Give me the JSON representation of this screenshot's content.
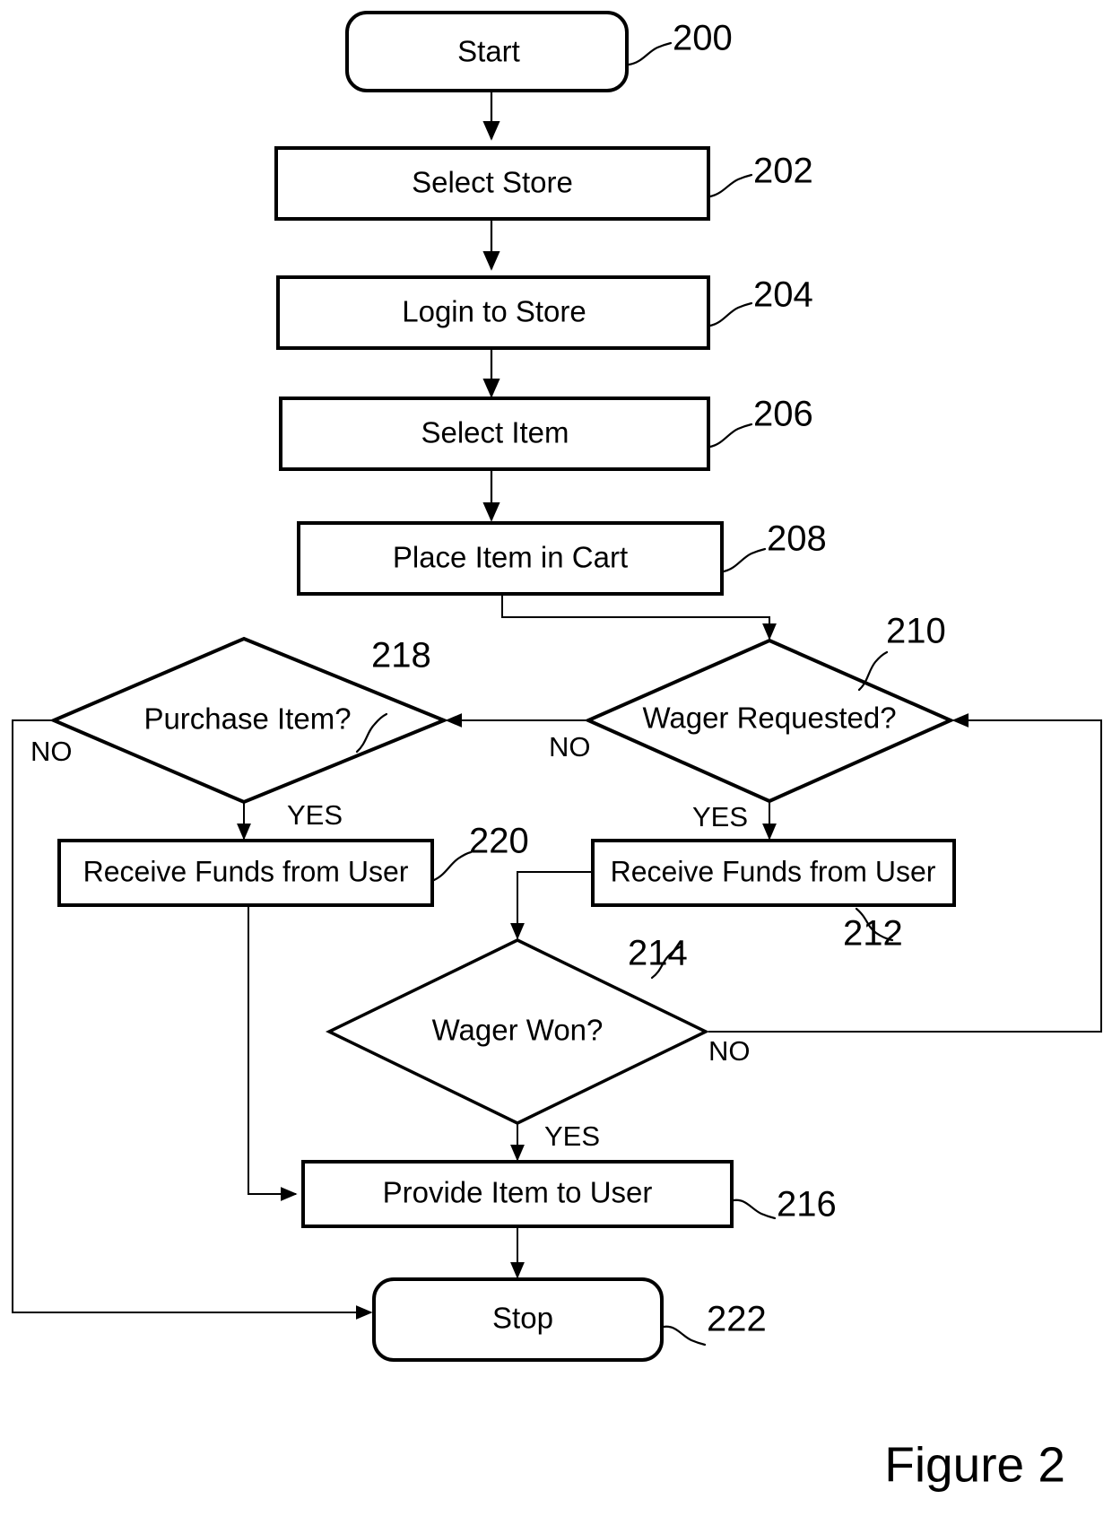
{
  "figure": {
    "caption": "Figure 2"
  },
  "nodes": [
    {
      "id": "start",
      "label": "Start",
      "ref": "200",
      "shape": "terminator"
    },
    {
      "id": "n202",
      "label": "Select Store",
      "ref": "202",
      "shape": "process"
    },
    {
      "id": "n204",
      "label": "Login to Store",
      "ref": "204",
      "shape": "process"
    },
    {
      "id": "n206",
      "label": "Select Item",
      "ref": "206",
      "shape": "process"
    },
    {
      "id": "n208",
      "label": "Place Item in Cart",
      "ref": "208",
      "shape": "process"
    },
    {
      "id": "n210",
      "label": "Wager Requested?",
      "ref": "210",
      "shape": "decision"
    },
    {
      "id": "n212",
      "label": "Receive Funds from User",
      "ref": "212",
      "shape": "process"
    },
    {
      "id": "n214",
      "label": "Wager Won?",
      "ref": "214",
      "shape": "decision"
    },
    {
      "id": "n216",
      "label": "Provide Item to User",
      "ref": "216",
      "shape": "process"
    },
    {
      "id": "n218",
      "label": "Purchase Item?",
      "ref": "218",
      "shape": "decision"
    },
    {
      "id": "n220",
      "label": "Receive Funds from User",
      "ref": "220",
      "shape": "process"
    },
    {
      "id": "stop",
      "label": "Stop",
      "ref": "222",
      "shape": "terminator"
    }
  ],
  "branch_labels": {
    "n210_no": "NO",
    "n210_yes": "YES",
    "n214_no": "NO",
    "n214_yes": "YES",
    "n218_no": "NO",
    "n218_yes": "YES"
  },
  "edges": [
    {
      "from": "start",
      "to": "n202",
      "label": ""
    },
    {
      "from": "n202",
      "to": "n204",
      "label": ""
    },
    {
      "from": "n204",
      "to": "n206",
      "label": ""
    },
    {
      "from": "n206",
      "to": "n208",
      "label": ""
    },
    {
      "from": "n208",
      "to": "n210",
      "label": ""
    },
    {
      "from": "n210",
      "to": "n218",
      "label": "NO"
    },
    {
      "from": "n210",
      "to": "n212",
      "label": "YES"
    },
    {
      "from": "n212",
      "to": "n214",
      "label": ""
    },
    {
      "from": "n214",
      "to": "n210",
      "label": "NO"
    },
    {
      "from": "n214",
      "to": "n216",
      "label": "YES"
    },
    {
      "from": "n218",
      "to": "stop",
      "label": "NO"
    },
    {
      "from": "n218",
      "to": "n220",
      "label": "YES"
    },
    {
      "from": "n220",
      "to": "n216",
      "label": ""
    },
    {
      "from": "n216",
      "to": "stop",
      "label": ""
    }
  ],
  "colors": {
    "stroke": "#000000",
    "fill": "#ffffff",
    "background": "#ffffff"
  }
}
